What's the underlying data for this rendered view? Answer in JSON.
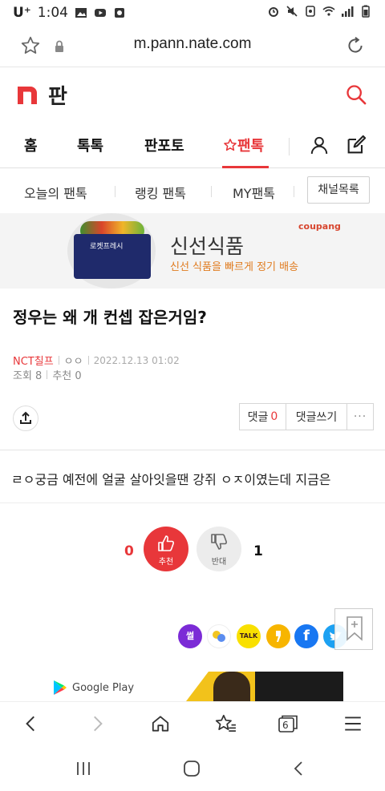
{
  "statusbar": {
    "carrier": "U⁺",
    "time": "1:04",
    "battery": "battery"
  },
  "browser": {
    "url": "m.pann.nate.com",
    "bookmark_icon": "star-outline",
    "lock_icon": "lock",
    "reload_icon": "reload"
  },
  "site": {
    "brand_text": "판",
    "accent": "#e8373a"
  },
  "tabs": [
    {
      "label": "홈"
    },
    {
      "label": "톡톡"
    },
    {
      "label": "판포토"
    },
    {
      "label": "팬톡"
    }
  ],
  "subnav": {
    "items": [
      {
        "label": "오늘의 팬톡"
      },
      {
        "label": "랭킹 팬톡"
      },
      {
        "label": "MY팬톡"
      }
    ],
    "channel_button": "채널목록"
  },
  "banner": {
    "title": "신선식품",
    "subtitle": "신선 식품을 빠르게 정기 배송",
    "logo": "coupang",
    "box_label": "로켓프레시"
  },
  "post": {
    "title": "정우는 왜 개 컨셉 잡은거임?",
    "author": "NCT칠프",
    "nickname": "ㅇㅇ",
    "date": "2022.12.13 01:02",
    "views": "조회 8",
    "recommends": "추천 0",
    "content": "ㄹㅇ궁금 예전에 얼굴 살아잇을땐 강쥐 ㅇㅈ이였는데 지금은"
  },
  "actions": {
    "comment_label": "댓글",
    "comment_count": "0",
    "write_comment": "댓글쓰기",
    "more": "···"
  },
  "vote": {
    "up_count": "0",
    "up_label": "추천",
    "down_count": "1",
    "down_label": "반대"
  },
  "share_icons": [
    {
      "name": "ssul",
      "label": "썰",
      "color": "#7b2bd6"
    },
    {
      "name": "band",
      "label": "",
      "color": "#ffffff"
    },
    {
      "name": "kakaotalk",
      "label": "TALK",
      "color": "#f9e000"
    },
    {
      "name": "kakaostory",
      "label": "",
      "color": "#f7b500"
    },
    {
      "name": "facebook",
      "label": "f",
      "color": "#1877f2"
    },
    {
      "name": "twitter",
      "label": "",
      "color": "#1da1f2"
    }
  ],
  "ad": {
    "store_label": "Google Play"
  },
  "browser_nav": {
    "tabs_count": "6"
  }
}
